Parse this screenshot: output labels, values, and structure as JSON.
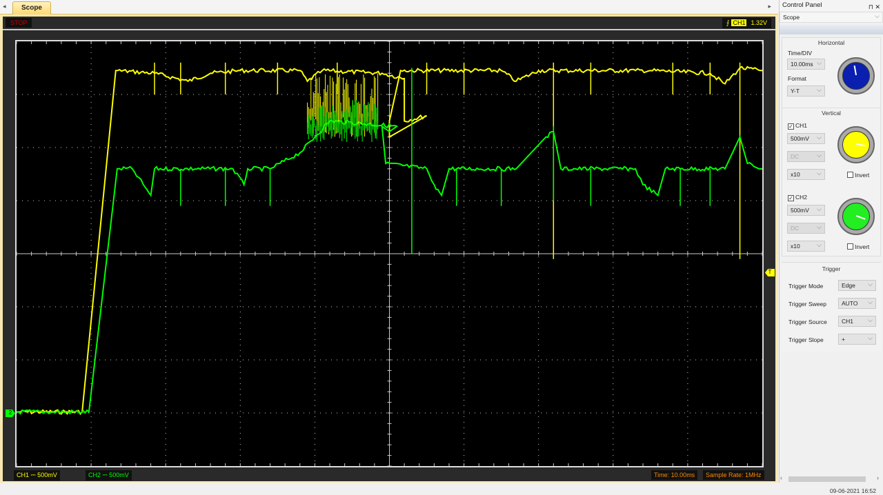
{
  "tabs": {
    "left_arrow": "◂",
    "active": "Scope",
    "right_arrow": "▸"
  },
  "scope": {
    "status": "STOP",
    "trigger_channel": "CH1",
    "trigger_level": "1.32V",
    "trigger_marker": "T",
    "ch_marker": "2",
    "footer": {
      "ch1": "CH1 ⎓ 500mV",
      "ch2": "CH2 ⎓ 500mV",
      "time": "Time: 10.00ms",
      "sample_rate": "Sample Rate: 1MHz"
    },
    "colors": {
      "ch1": "#ffff00",
      "ch2": "#00ff00",
      "grid": "#cccccc"
    }
  },
  "control_panel": {
    "title": "Control Panel",
    "pin_icon": "⊓",
    "close_icon": "✕",
    "mode": "Scope",
    "horizontal": {
      "title": "Horizontal",
      "time_div_label": "Time/DIV",
      "time_div": "10.00ms",
      "format_label": "Format",
      "format": "Y-T"
    },
    "vertical": {
      "title": "Vertical",
      "ch1": {
        "label": "CH1",
        "checked": true,
        "volts": "500mV",
        "coupling": "DC",
        "probe": "x10",
        "invert": "Invert"
      },
      "ch2": {
        "label": "CH2",
        "checked": true,
        "volts": "500mV",
        "coupling": "DC",
        "probe": "x10",
        "invert": "Invert"
      }
    },
    "trigger": {
      "title": "Trigger",
      "mode_label": "Trigger Mode",
      "mode": "Edge",
      "sweep_label": "Trigger Sweep",
      "sweep": "AUTO",
      "source_label": "Trigger Source",
      "source": "CH1",
      "slope_label": "Trigger Slope",
      "slope": "+"
    }
  },
  "status": {
    "datetime": "09-06-2021  16:52"
  },
  "waveforms": {
    "units": "x in divisions (0-10), y in divisions from center (-4..4)",
    "ch1": [
      [
        0,
        -2.98
      ],
      [
        0.88,
        -2.98
      ],
      [
        1.33,
        3.45
      ],
      [
        1.85,
        3.4
      ],
      [
        2.3,
        3.25
      ],
      [
        2.6,
        3.4
      ],
      [
        3.0,
        3.45
      ],
      [
        3.8,
        3.45
      ],
      [
        3.9,
        3.25
      ],
      [
        4.1,
        3.45
      ],
      [
        4.9,
        3.4
      ],
      [
        5.2,
        3.3
      ],
      [
        5.2,
        2.5
      ],
      [
        5.5,
        2.6
      ],
      [
        5.0,
        2.2
      ],
      [
        5.0,
        2.5
      ],
      [
        5.15,
        3.45
      ],
      [
        6.5,
        3.45
      ],
      [
        6.7,
        3.25
      ],
      [
        7.0,
        3.45
      ],
      [
        8.3,
        3.45
      ],
      [
        8.5,
        3.45
      ],
      [
        9.3,
        3.4
      ],
      [
        9.5,
        3.2
      ],
      [
        9.7,
        3.5
      ],
      [
        10,
        3.45
      ]
    ],
    "ch2": [
      [
        0,
        -2.98
      ],
      [
        0.97,
        -2.98
      ],
      [
        1.35,
        1.6
      ],
      [
        1.55,
        1.6
      ],
      [
        1.7,
        1.3
      ],
      [
        1.8,
        1.1
      ],
      [
        1.85,
        1.6
      ],
      [
        2.9,
        1.6
      ],
      [
        3.05,
        1.3
      ],
      [
        3.1,
        1.6
      ],
      [
        3.4,
        1.6
      ],
      [
        3.8,
        1.9
      ],
      [
        4.0,
        2.2
      ],
      [
        4.2,
        2.5
      ],
      [
        5.1,
        2.4
      ],
      [
        5.0,
        2.3
      ],
      [
        4.9,
        2.4
      ],
      [
        4.95,
        1.7
      ],
      [
        5.5,
        1.6
      ],
      [
        5.6,
        1.3
      ],
      [
        5.7,
        1.1
      ],
      [
        5.8,
        1.6
      ],
      [
        6.7,
        1.6
      ],
      [
        7.1,
        2.2
      ],
      [
        7.2,
        2.3
      ],
      [
        7.3,
        1.6
      ],
      [
        8.3,
        1.6
      ],
      [
        8.4,
        1.3
      ],
      [
        8.6,
        1.1
      ],
      [
        8.7,
        1.6
      ],
      [
        9.5,
        1.6
      ],
      [
        9.7,
        2.2
      ],
      [
        9.8,
        1.7
      ],
      [
        10,
        1.6
      ]
    ]
  }
}
